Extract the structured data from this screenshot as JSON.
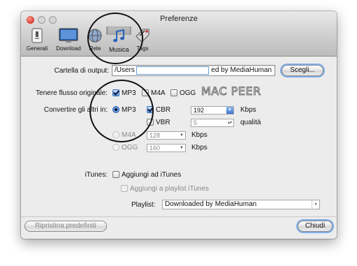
{
  "window": {
    "title": "Preferenze"
  },
  "toolbar": [
    {
      "label": "Generali",
      "icon": "phone-switch-icon"
    },
    {
      "label": "Download",
      "icon": "monitor-icon"
    },
    {
      "label": "Rete",
      "icon": "globe-icon"
    },
    {
      "label": "Musica",
      "icon": "music-note-icon",
      "selected": true
    },
    {
      "label": "Tags",
      "icon": "tag-icon"
    }
  ],
  "output": {
    "label": "Cartella di output:",
    "path_left": "/Users",
    "path_right": "ed by MediaHuman",
    "choose_label": "Scegli..."
  },
  "keep_original": {
    "label": "Tenere flusso originale:",
    "options": [
      {
        "label": "MP3",
        "checked": true
      },
      {
        "label": "M4A",
        "checked": false
      },
      {
        "label": "OGG",
        "checked": false
      }
    ]
  },
  "watermark": "MAC PEER",
  "convert": {
    "label": "Convertire gli altri in:",
    "mp3": {
      "label": "MP3",
      "cbr_label": "CBR",
      "cbr_value": "192",
      "cbr_unit": "Kbps",
      "vbr_label": "VBR",
      "vbr_value": "5",
      "vbr_unit": "qualità"
    },
    "m4a": {
      "label": "M4A",
      "value": "128",
      "unit": "Kbps"
    },
    "ogg": {
      "label": "OGG",
      "value": "160",
      "unit": "Kbps"
    }
  },
  "itunes": {
    "label": "iTunes:",
    "add_label": "Aggiungi ad iTunes",
    "add_playlist_label": "Aggiungi a playlist iTunes",
    "playlist_label": "Playlist:",
    "playlist_value": "Downloaded by MediaHuman"
  },
  "footer": {
    "reset_label": "Ripristina predefiniti",
    "close_label": "Chiudi"
  }
}
